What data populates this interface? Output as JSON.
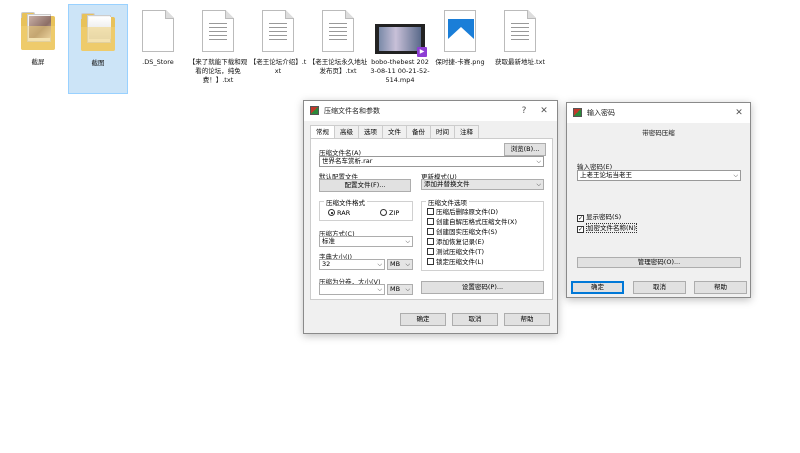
{
  "desktop": {
    "files": [
      {
        "label": "截屏",
        "type": "folder"
      },
      {
        "label": "截图",
        "type": "folder"
      },
      {
        "label": ".DS_Store",
        "type": "file"
      },
      {
        "label": "【来了就能下载和观看的论坛，纯免费！】.txt",
        "type": "text"
      },
      {
        "label": "【老王论坛介绍】.txt",
        "type": "text"
      },
      {
        "label": "【老王论坛永久地址发布页】.txt",
        "type": "text"
      },
      {
        "label": "bobo-thebest 2023-08-11 00-21-52-514.mp4",
        "type": "video"
      },
      {
        "label": "保时捷-卡赛.png",
        "type": "image"
      },
      {
        "label": "获取最新地址.txt",
        "type": "text"
      }
    ]
  },
  "archive_dialog": {
    "title": "压缩文件名和参数",
    "help": "?",
    "close": "✕",
    "tabs": [
      "常规",
      "高级",
      "选项",
      "文件",
      "备份",
      "时间",
      "注释"
    ],
    "archive_name_label": "压缩文件名(A)",
    "browse_button": "浏览(B)...",
    "archive_name_value": "世界名车赏析.rar",
    "default_profile_label": "默认配置文件",
    "profile_button": "配置文件(F)...",
    "update_mode_label": "更新模式(U)",
    "update_mode_value": "添加并替换文件",
    "format_group_title": "压缩文件格式",
    "format_rar": "RAR",
    "format_zip": "ZIP",
    "method_label": "压缩方式(C)",
    "method_value": "标准",
    "dict_label": "字典大小(I)",
    "dict_value": "32",
    "dict_unit": "MB",
    "split_label": "压缩为分卷，大小(V)",
    "split_value": "",
    "split_unit": "MB",
    "options_group_title": "压缩文件选项",
    "options": [
      {
        "label": "压缩后删除原文件(D)",
        "checked": false
      },
      {
        "label": "创建自解压格式压缩文件(X)",
        "checked": false
      },
      {
        "label": "创建固实压缩文件(S)",
        "checked": false
      },
      {
        "label": "添加恢复记录(E)",
        "checked": false
      },
      {
        "label": "测试压缩文件(T)",
        "checked": false
      },
      {
        "label": "锁定压缩文件(L)",
        "checked": false
      }
    ],
    "set_password_button": "设置密码(P)...",
    "ok_button": "确定",
    "cancel_button": "取消",
    "help_button": "帮助"
  },
  "password_dialog": {
    "title": "输入密码",
    "close": "✕",
    "subtitle": "带密码压缩",
    "password_label": "输入密码(E)",
    "password_value": "上老王论坛当老王",
    "show_password": "显示密码(S)",
    "encrypt_names": "加密文件名称(N)",
    "manage_button": "管理密码(O)...",
    "ok_button": "确定",
    "cancel_button": "取消",
    "help_button": "帮助"
  }
}
